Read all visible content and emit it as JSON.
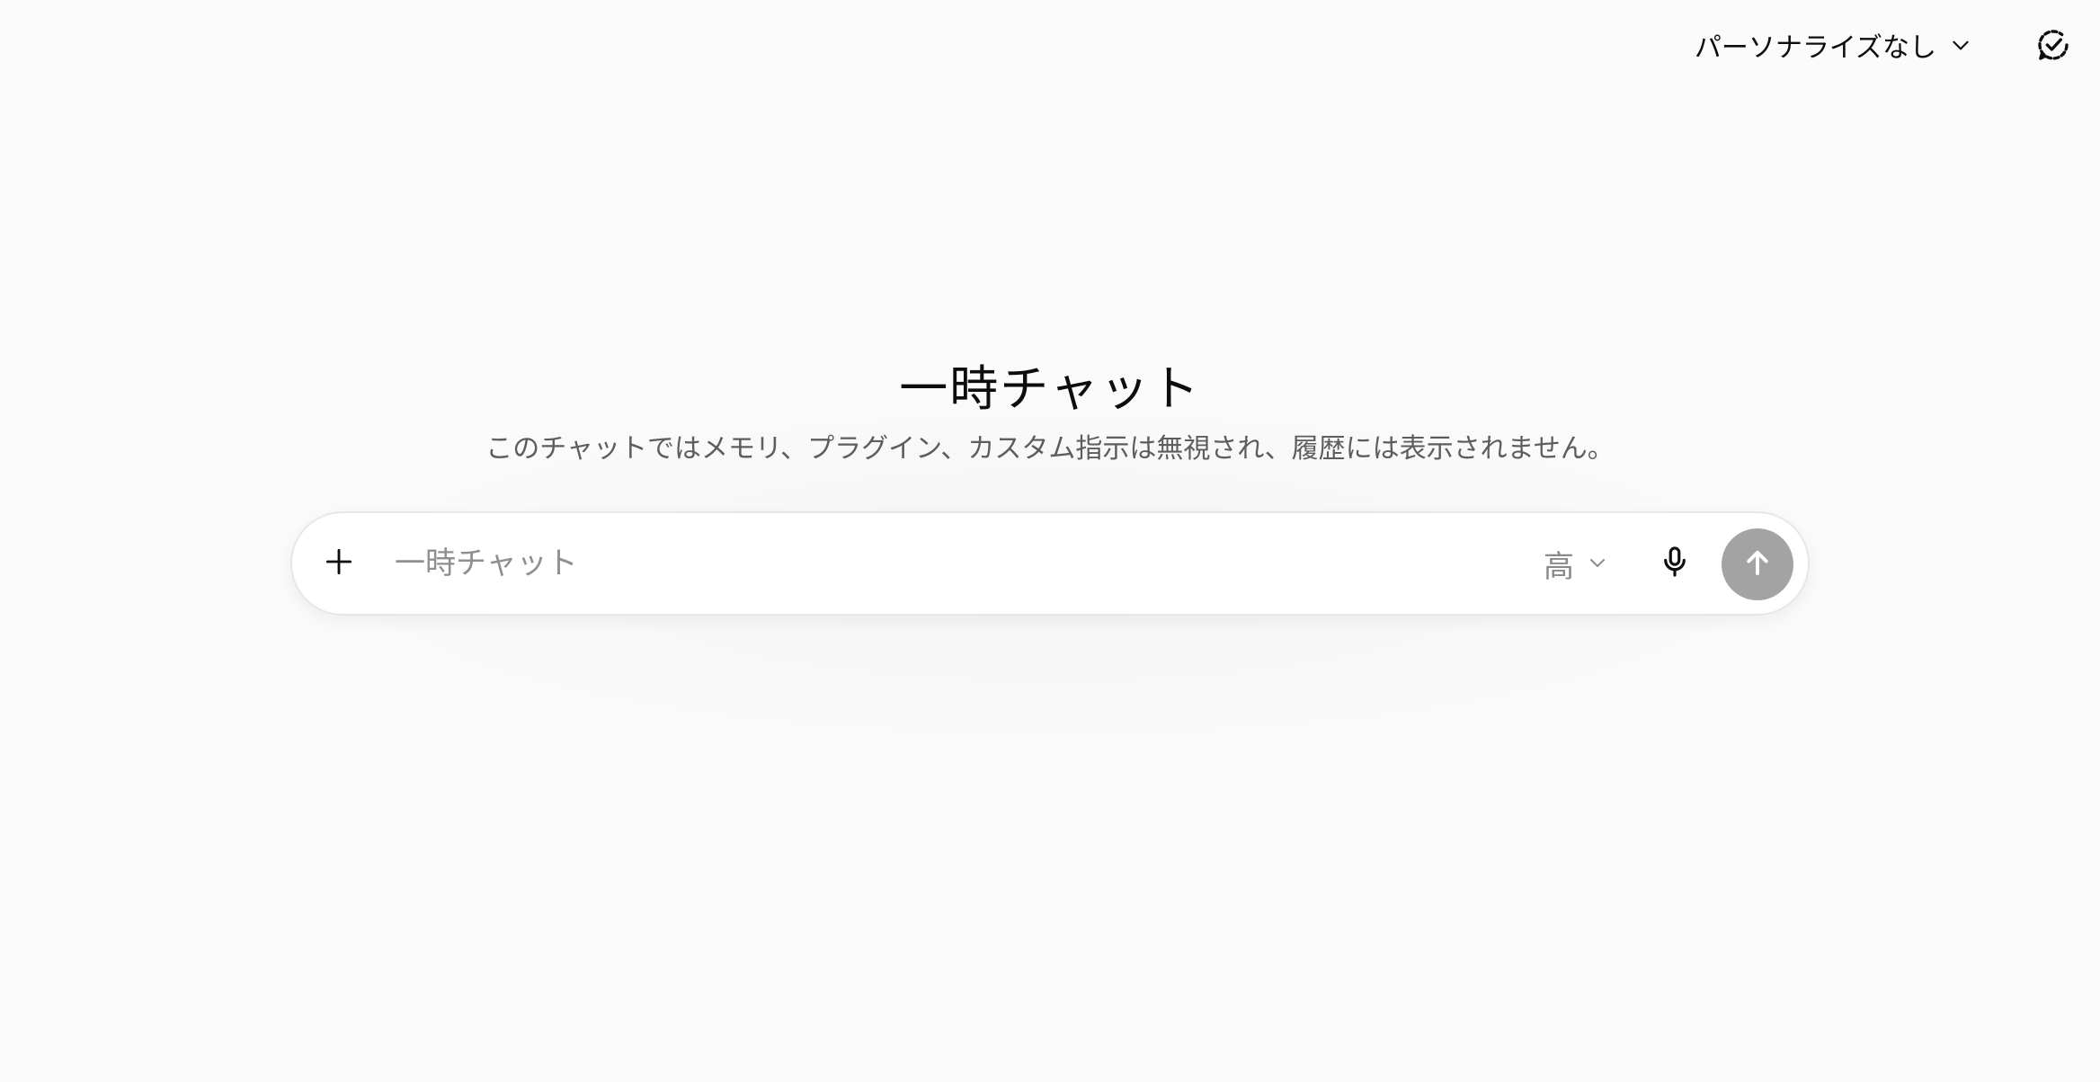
{
  "topbar": {
    "personalization_label": "パーソナライズなし"
  },
  "hero": {
    "title": "一時チャット",
    "subtitle": "このチャットではメモリ、プラグイン、カスタム指示は無視され、履歴には表示されません。"
  },
  "composer": {
    "placeholder": "一時チャット",
    "value": "",
    "model_label": "高"
  },
  "icons": {
    "personalization_chevron": "chevron-down-icon",
    "temporary_chat": "chat-check-icon",
    "attach": "plus-icon",
    "model_chevron": "chevron-down-icon",
    "voice": "microphone-icon",
    "send": "arrow-up-icon"
  },
  "colors": {
    "background": "#fbfbfb",
    "send_button_disabled": "#a3a3a3",
    "text_primary": "#0d0d0d",
    "text_secondary": "#5d5d5d"
  }
}
